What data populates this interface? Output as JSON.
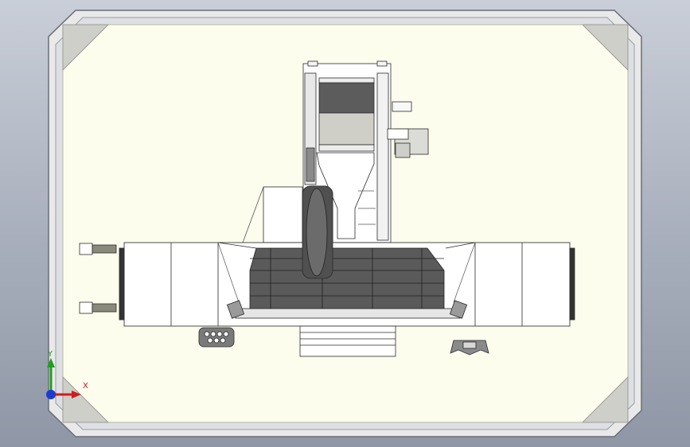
{
  "viewport": {
    "background_top": "#c9ced8",
    "background_bottom": "#8f97a6"
  },
  "drawing_sheet": {
    "sheet_color": "#fdfdee",
    "frame_outer_color": "#e9e9ea",
    "corner_bevel_color": "#c9c9c5"
  },
  "model": {
    "description_icon": "cnc-gantry-machine-top-view",
    "gantry_color": "#ffffff",
    "slat_cover_color": "#555555",
    "spindle_head_color": "#5c5c5c"
  },
  "triad": {
    "x_label": "X",
    "y_label": "Y",
    "x_color": "#d01c1c",
    "y_color": "#1ca01c",
    "z_color": "#1c3cd0"
  }
}
